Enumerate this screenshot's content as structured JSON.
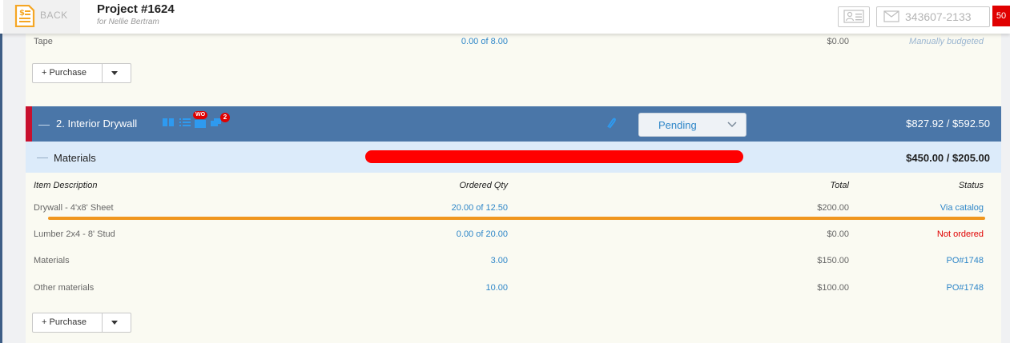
{
  "header": {
    "back_label": "BACK",
    "project_title": "Project #1624",
    "project_subtitle": "for Nellie Bertram",
    "phone": "343607-2133",
    "badge_count": "50"
  },
  "tape_row": {
    "description": "Tape",
    "qty": "0.00 of 8.00",
    "total": "$0.00",
    "status": "Manually budgeted"
  },
  "purchase_button_label": "+ Purchase",
  "section": {
    "title": "2. Interior Drywall",
    "wo_badge": "WO",
    "count_badge": "2",
    "status_value": "Pending",
    "total": "$827.92 / $592.50"
  },
  "materials": {
    "title": "Materials",
    "total": "$450.00 / $205.00",
    "columns": [
      "Item Description",
      "Ordered Qty",
      "Total",
      "Status"
    ],
    "rows": [
      {
        "description": "Drywall - 4'x8' Sheet",
        "qty": "20.00 of 12.50",
        "total": "$200.00",
        "status": "Via catalog"
      },
      {
        "description": "Lumber 2x4 - 8' Stud",
        "qty": "0.00 of 20.00",
        "total": "$0.00",
        "status": "Not ordered"
      },
      {
        "description": "Materials",
        "qty": "3.00",
        "total": "$150.00",
        "status": "PO#1748"
      },
      {
        "description": "Other materials",
        "qty": "10.00",
        "total": "$100.00",
        "status": "PO#1748"
      }
    ]
  },
  "colors": {
    "section_bg": "#4a76a8",
    "materials_bg": "#dcebfa",
    "link_blue": "#2e86c8",
    "not_ordered_red": "#e00000",
    "annotation_red": "#ff0000",
    "annotation_orange": "#f0961e"
  }
}
